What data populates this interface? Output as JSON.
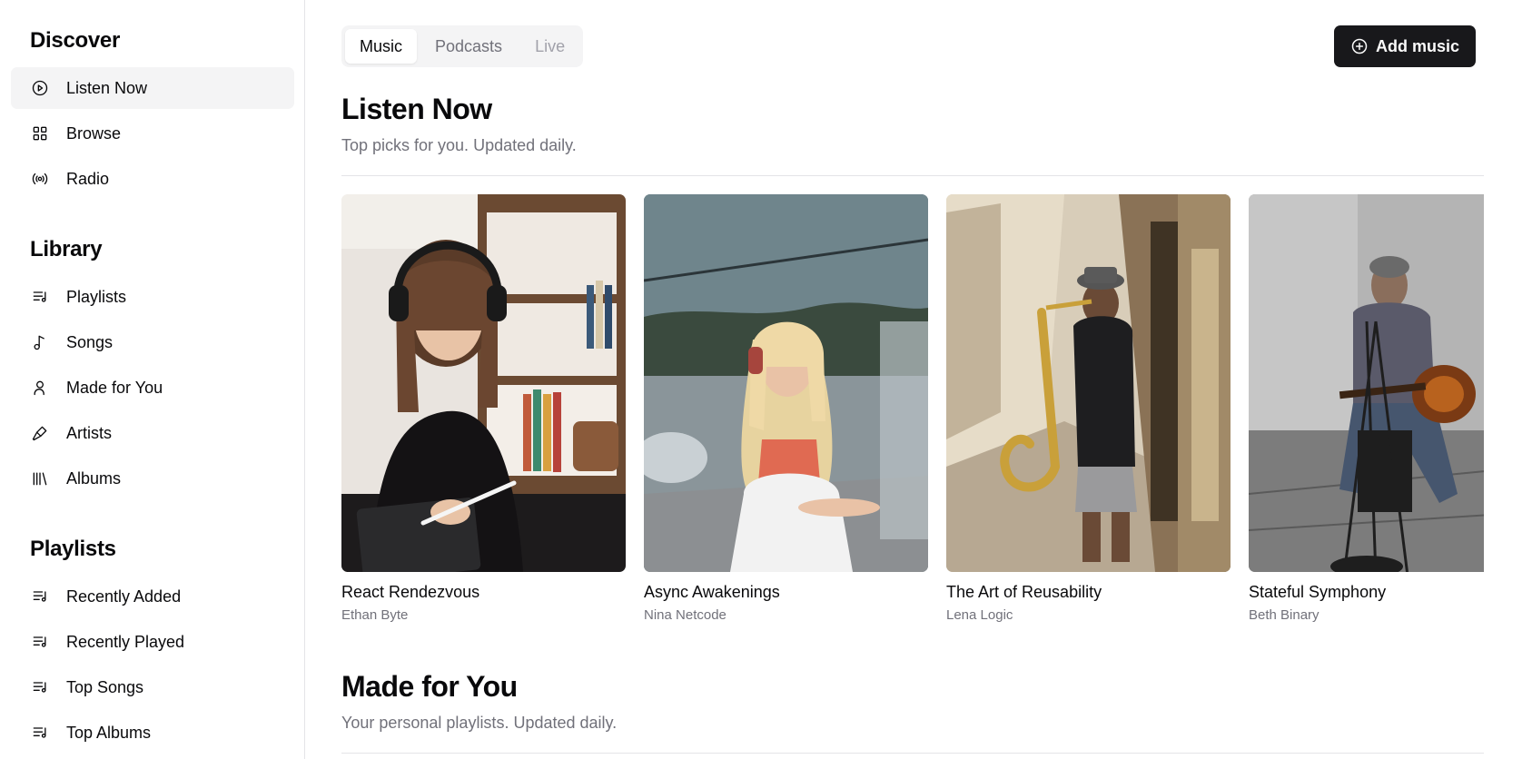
{
  "sidebar": {
    "sections": [
      {
        "title": "Discover",
        "items": [
          {
            "label": "Listen Now",
            "icon": "play-circle-icon",
            "active": true
          },
          {
            "label": "Browse",
            "icon": "grid-icon"
          },
          {
            "label": "Radio",
            "icon": "radio-icon"
          }
        ]
      },
      {
        "title": "Library",
        "items": [
          {
            "label": "Playlists",
            "icon": "playlist-icon"
          },
          {
            "label": "Songs",
            "icon": "music-note-icon"
          },
          {
            "label": "Made for You",
            "icon": "user-icon"
          },
          {
            "label": "Artists",
            "icon": "microphone-icon"
          },
          {
            "label": "Albums",
            "icon": "library-icon"
          }
        ]
      },
      {
        "title": "Playlists",
        "items": [
          {
            "label": "Recently Added",
            "icon": "playlist-icon"
          },
          {
            "label": "Recently Played",
            "icon": "playlist-icon"
          },
          {
            "label": "Top Songs",
            "icon": "playlist-icon"
          },
          {
            "label": "Top Albums",
            "icon": "playlist-icon"
          }
        ]
      }
    ]
  },
  "tabs": [
    {
      "label": "Music",
      "state": "active"
    },
    {
      "label": "Podcasts",
      "state": "normal"
    },
    {
      "label": "Live",
      "state": "disabled"
    }
  ],
  "add_button": {
    "label": "Add music",
    "icon": "plus-circle-icon"
  },
  "listen_now": {
    "title": "Listen Now",
    "subtitle": "Top picks for you. Updated daily.",
    "albums": [
      {
        "title": "React Rendezvous",
        "artist": "Ethan Byte"
      },
      {
        "title": "Async Awakenings",
        "artist": "Nina Netcode"
      },
      {
        "title": "The Art of Reusability",
        "artist": "Lena Logic"
      },
      {
        "title": "Stateful Symphony",
        "artist": "Beth Binary"
      }
    ]
  },
  "made_for_you": {
    "title": "Made for You",
    "subtitle": "Your personal playlists. Updated daily."
  },
  "colors": {
    "accent": "#18181b",
    "muted": "#71717a",
    "active_bg": "#f4f4f5",
    "border": "#e4e4e7"
  }
}
